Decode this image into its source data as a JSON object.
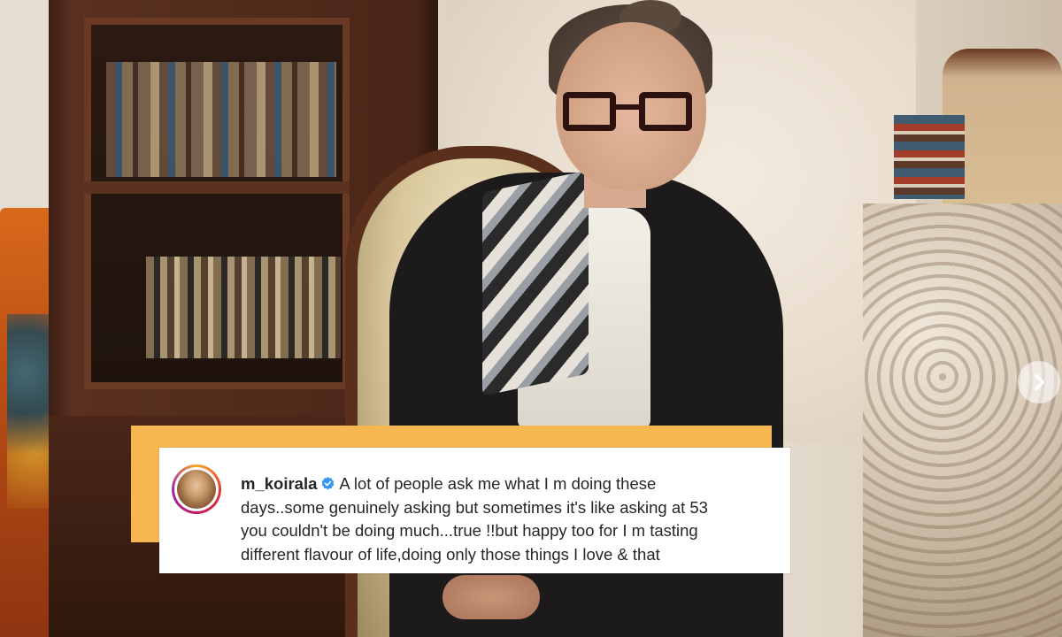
{
  "comment": {
    "username": "m_koirala",
    "lines": [
      "A lot of people ask me what I m doing these",
      "days..some genuinely asking but sometimes it's like asking at 53",
      "you couldn't be doing much...true !!but happy too for I m tasting",
      "different flavour of life,doing only those things I love & that"
    ]
  },
  "colors": {
    "accent_block": "#f7b750",
    "verified_badge": "#3897f0",
    "card_background": "#ffffff"
  },
  "icons": {
    "verified": "verified-badge-icon",
    "carousel_next": "chevron-right-icon"
  }
}
